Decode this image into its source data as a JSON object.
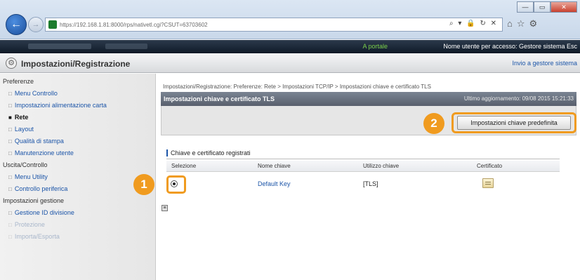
{
  "browser": {
    "url": "https://192.168.1.81:8000/rps/nativetl.cgi?CSUT=63703602",
    "window_buttons": [
      "—",
      "▭",
      "✕"
    ],
    "addr_tools": "⌕ ▾ 🔒 ↻ ✕",
    "toolbar_icons": [
      "⌂",
      "☆",
      "⚙"
    ]
  },
  "topbar": {
    "portal_link": "A portale",
    "user_info": "Nome utente per accesso: Gestore sistema Esc"
  },
  "titlebar": {
    "title": "Impostazioni/Registrazione",
    "goto_admin": "Invio a gestore sistema"
  },
  "sidebar": {
    "groups": [
      {
        "heading": "Preferenze",
        "items": [
          "Menu Controllo",
          "Impostazioni alimentazione carta",
          "Rete",
          "Layout",
          "Qualità di stampa",
          "Manutenzione utente"
        ]
      },
      {
        "heading": "Uscita/Controllo",
        "items": [
          "Menu Utility",
          "Controllo periferica"
        ]
      },
      {
        "heading": "Impostazioni gestione",
        "items": [
          "Gestione ID divisione",
          "Protezione",
          "Importa/Esporta"
        ]
      }
    ]
  },
  "main": {
    "breadcrumb": "Impostazioni/Registrazione: Preferenze: Rete > Impostazioni TCP/IP > Impostazioni chiave e certificato TLS",
    "panel_title": "Impostazioni chiave e certificato TLS",
    "last_update": "Ultimo aggiornamento: 09/08 2015 15:21:33",
    "default_key_button": "Impostazioni chiave predefinita",
    "section_title": "Chiave e certificato registrati",
    "columns": [
      "Selezione",
      "Nome chiave",
      "Utilizzo chiave",
      "Certificato"
    ],
    "rows": [
      {
        "selected": true,
        "key_name": "Default Key",
        "key_usage": "[TLS]",
        "certificate_icon": "certificate-icon"
      }
    ]
  },
  "callouts": [
    "1",
    "2"
  ],
  "colors": {
    "accent": "#f09b1f",
    "link": "#1c55a8",
    "header_dark": "#1a2535"
  }
}
